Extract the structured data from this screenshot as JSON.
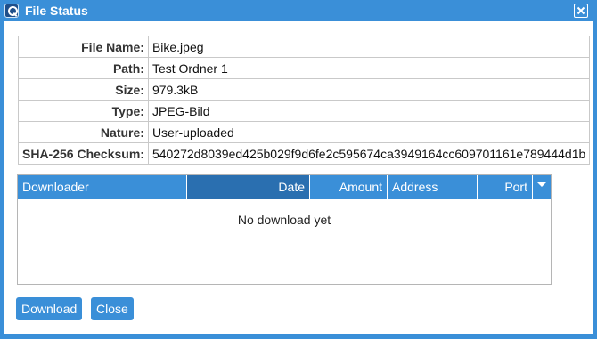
{
  "window": {
    "title": "File Status"
  },
  "file_info": [
    {
      "label": "File Name:",
      "value": "Bike.jpeg"
    },
    {
      "label": "Path:",
      "value": "Test Ordner 1"
    },
    {
      "label": "Size:",
      "value": "979.3kB"
    },
    {
      "label": "Type:",
      "value": "JPEG-Bild"
    },
    {
      "label": "Nature:",
      "value": "User-uploaded"
    },
    {
      "label": "SHA-256 Checksum:",
      "value": "540272d8039ed425b029f9d6fe2c595674ca3949164cc609701161e789444d1b"
    }
  ],
  "downloads_grid": {
    "columns": [
      "Downloader",
      "Date",
      "Amount",
      "Address",
      "Port"
    ],
    "sorted_column": "Date",
    "empty_message": "No download yet"
  },
  "buttons": {
    "download": "Download",
    "close": "Close"
  },
  "colors": {
    "accent": "#3a8fd8",
    "sorted_header": "#2a6fb0"
  }
}
